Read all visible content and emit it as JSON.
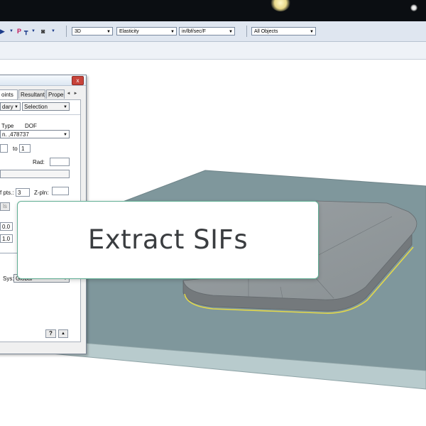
{
  "toolbar": {
    "view_mode": "3D",
    "analysis_type": "Elasticity",
    "units": "in/lbf/sec/F",
    "object_filter": "All Objects",
    "icons": [
      "select-arrow-icon",
      "point-icon",
      "tree-icon",
      "camera-icon"
    ],
    "icon_text_p": "P"
  },
  "dialog": {
    "close_label": "x",
    "tabs": [
      {
        "label": "oints"
      },
      {
        "label": "Resultant"
      },
      {
        "label": "Proper"
      }
    ],
    "tab_scroll_left": "◄",
    "tab_scroll_right": "►",
    "boundary_combo": "dary",
    "selection_combo": "Selection",
    "header_type": "Type",
    "header_dof": "DOF",
    "list_value": "n.    ,478737",
    "range_to": "to",
    "range_end": "1",
    "rad_label": "Rad:",
    "pts_label": "f pts.:",
    "pts_value": "3",
    "zpln_label": "Z-pln:",
    "side_button": "ls",
    "value_1": "0.0",
    "value_2": "1.0",
    "sys_label": "Sys:",
    "sys_value": "Global",
    "help_button": "?",
    "up_button": "▲"
  },
  "overlay": {
    "title": "Extract SIFs"
  },
  "colors": {
    "plate_top": "#7f979c",
    "plate_side": "#b7cacc",
    "accent_card_border": "#5fae93"
  }
}
